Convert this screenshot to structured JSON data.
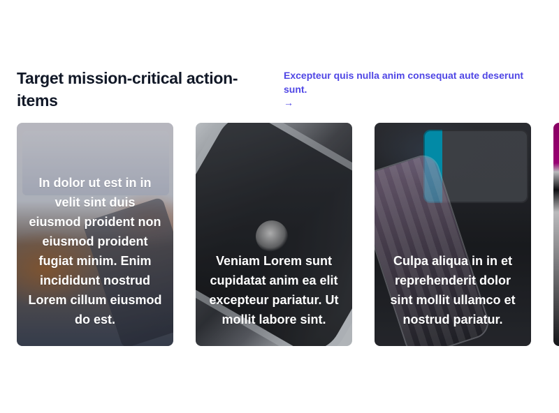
{
  "section": {
    "title": "Target mission-critical action-items",
    "aside_text": "Excepteur quis nulla anim consequat aute deserunt sunt.",
    "aside_link_label": "→",
    "colors": {
      "title": "#111827",
      "accent": "#4f46e5",
      "card_text": "#ffffff"
    }
  },
  "cards": [
    {
      "text": "In dolor ut est in in velit sint duis eiusmod proident non eiusmod proident fugiat minim. Enim incididunt nostrud Lorem cillum eiusmod do est.",
      "image": "laptop-hands"
    },
    {
      "text": "Veniam Lorem sunt cupidatat anim ea elit excepteur pariatur. Ut mollit labore sint.",
      "image": "phone-closeup"
    },
    {
      "text": "Culpa aliqua in in et reprehenderit dolor sint mollit ullamco et nostrud pariatur.",
      "image": "phone-keyboard"
    },
    {
      "text": "",
      "image": "partial-colorful"
    }
  ]
}
